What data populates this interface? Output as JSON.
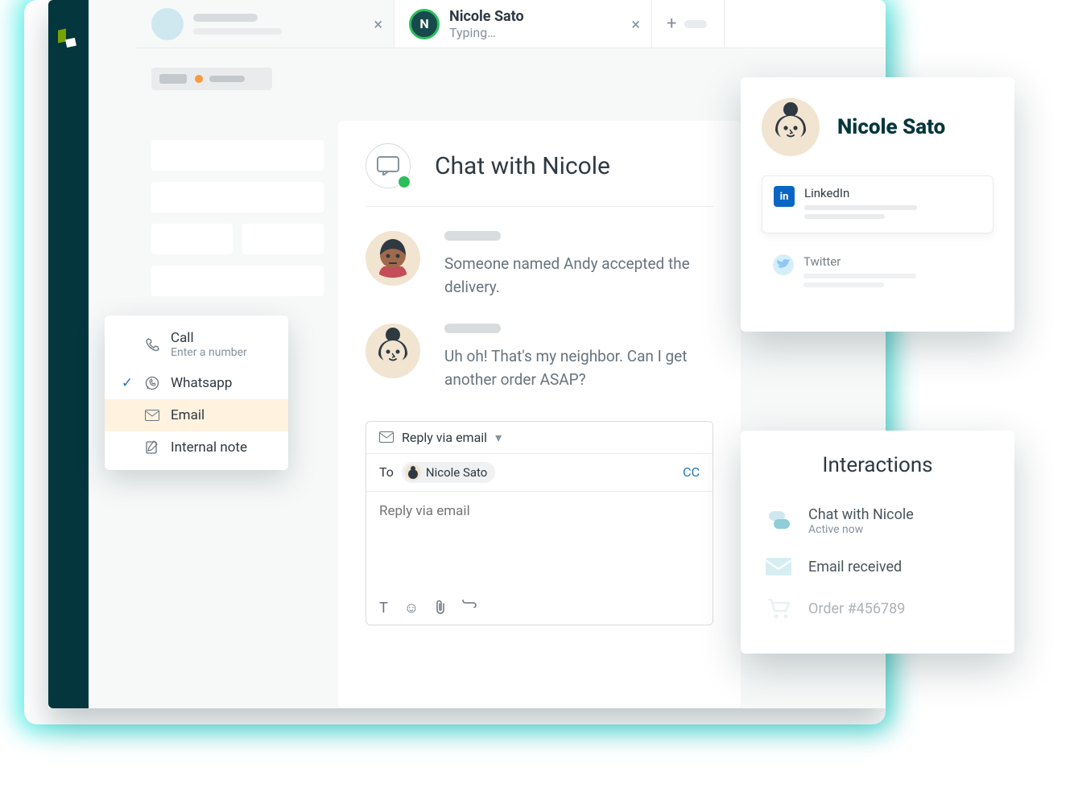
{
  "tabs": {
    "inactive": {
      "close": "×"
    },
    "active": {
      "initial": "N",
      "name": "Nicole Sato",
      "status": "Typing…",
      "close": "×"
    },
    "add": {
      "plus": "+"
    }
  },
  "channel_menu": {
    "call": {
      "label": "Call",
      "sub": "Enter a number"
    },
    "whatsapp": {
      "label": "Whatsapp"
    },
    "email": {
      "label": "Email"
    },
    "note": {
      "label": "Internal note"
    }
  },
  "conversation": {
    "title": "Chat with Nicole",
    "messages": [
      {
        "text": "Someone named Andy accepted the delivery."
      },
      {
        "text": "Uh oh! That's my neighbor. Can I get another order ASAP?"
      }
    ]
  },
  "composer": {
    "mode_label": "Reply via email",
    "to_label": "To",
    "to_chip": "Nicole Sato",
    "cc": "CC",
    "placeholder": "Reply via email"
  },
  "profile": {
    "name": "Nicole Sato",
    "socials": {
      "linkedin": "LinkedIn",
      "twitter": "Twitter"
    }
  },
  "interactions": {
    "title": "Interactions",
    "items": [
      {
        "title": "Chat with Nicole",
        "sub": "Active now"
      },
      {
        "title": "Email received"
      },
      {
        "title": "Order #456789"
      }
    ]
  }
}
